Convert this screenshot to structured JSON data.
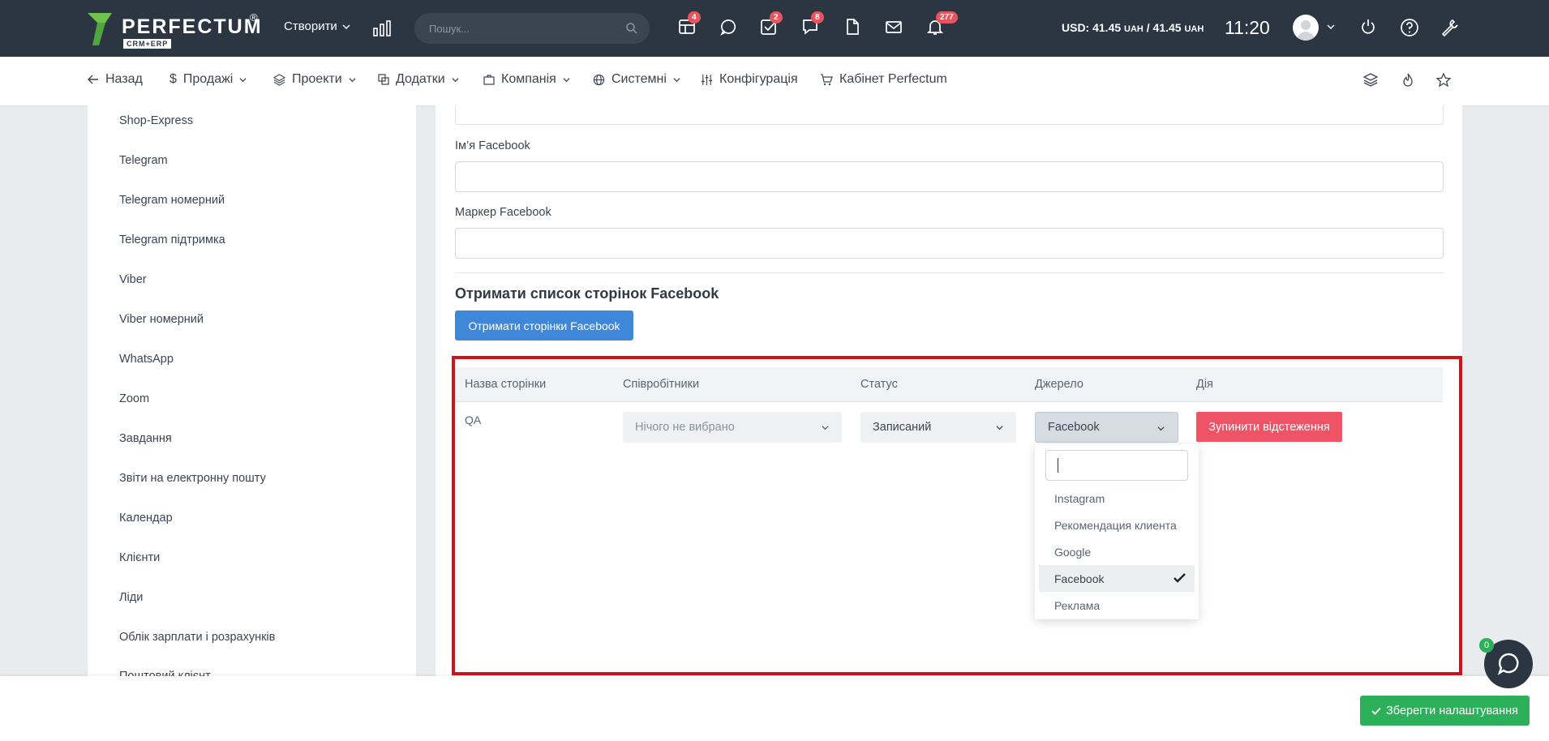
{
  "header": {
    "logo_text": "PERFECTUM",
    "logo_reg": "®",
    "logo_sub": "CRM+ERP",
    "create_label": "Створити",
    "search_placeholder": "Пошук...",
    "badges": {
      "dashboard": "4",
      "tasks": "2",
      "chat": "8",
      "notifications": "277"
    },
    "currency_prefix": "USD: 41.45",
    "currency_unit1": "UAH",
    "currency_mid": " / 41.45 ",
    "currency_unit2": "UAH",
    "time": "11:20"
  },
  "subnav": {
    "back": "Назад",
    "sales": "Продажі",
    "projects": "Проекти",
    "addons": "Додатки",
    "company": "Компанія",
    "system": "Системні",
    "config": "Конфігурація",
    "cabinet": "Кабінет Perfectum"
  },
  "sidebar": {
    "items": [
      "Shop-Express",
      "Telegram",
      "Telegram номерний",
      "Telegram підтримка",
      "Viber",
      "Viber номерний",
      "WhatsApp",
      "Zoom",
      "Завдання",
      "Звіти на електронну пошту",
      "Календар",
      "Клієнти",
      "Ліди",
      "Облік зарплати і розрахунків"
    ],
    "partial_item": "Поштовий клієнт"
  },
  "form": {
    "fb_name_label": "Ім’я Facebook",
    "fb_token_label": "Маркер Facebook",
    "section_title": "Отримати список сторінок Facebook",
    "get_pages_button": "Отримати сторінки Facebook"
  },
  "table": {
    "headers": [
      "Назва сторінки",
      "Співробітники",
      "Статус",
      "Джерело",
      "Дія"
    ],
    "row": {
      "page_name": "QA",
      "staff_placeholder": "Нічого не вибрано",
      "status": "Записаний",
      "source": "Facebook",
      "action": "Зупинити відстеження"
    }
  },
  "source_dropdown": {
    "search_value": "",
    "options": [
      "Instagram",
      "Рекомендация клиента",
      "Google",
      "Facebook",
      "Реклама"
    ],
    "selected": "Facebook"
  },
  "footer": {
    "save_button": "Зберегти налаштування",
    "chat_badge": "0"
  },
  "colors": {
    "topbar": "#2b3642",
    "primary_blue": "#3f88d9",
    "danger": "#ef5466",
    "success": "#2cb05a",
    "highlight_frame": "#d0121b"
  }
}
